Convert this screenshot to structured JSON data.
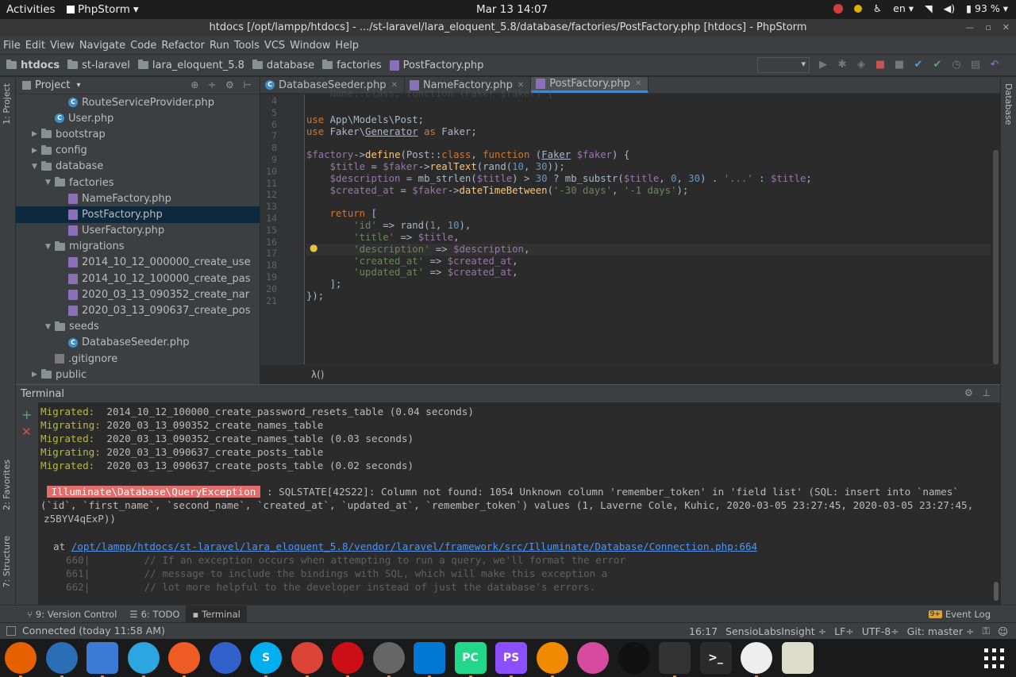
{
  "topbar": {
    "activities": "Activities",
    "app": "PhpStorm",
    "clock": "Mar 13  14:07",
    "lang": "en",
    "battery": "93 %"
  },
  "window": {
    "title": "htdocs [/opt/lampp/htdocs] - .../st-laravel/lara_eloquent_5.8/database/factories/PostFactory.php [htdocs] - PhpStorm"
  },
  "menu": [
    "File",
    "Edit",
    "View",
    "Navigate",
    "Code",
    "Refactor",
    "Run",
    "Tools",
    "VCS",
    "Window",
    "Help"
  ],
  "breadcrumbs": [
    "htdocs",
    "st-laravel",
    "lara_eloquent_5.8",
    "database",
    "factories",
    "PostFactory.php"
  ],
  "project": {
    "header": "Project",
    "tree": [
      {
        "label": "RouteServiceProvider.php",
        "icon": "class",
        "indent": 3,
        "arrow": ""
      },
      {
        "label": "User.php",
        "icon": "class",
        "indent": 2,
        "arrow": ""
      },
      {
        "label": "bootstrap",
        "icon": "folder",
        "indent": 1,
        "arrow": "▶"
      },
      {
        "label": "config",
        "icon": "folder",
        "indent": 1,
        "arrow": "▶"
      },
      {
        "label": "database",
        "icon": "folder",
        "indent": 1,
        "arrow": "▼"
      },
      {
        "label": "factories",
        "icon": "folder",
        "indent": 2,
        "arrow": "▼"
      },
      {
        "label": "NameFactory.php",
        "icon": "php",
        "indent": 3,
        "arrow": ""
      },
      {
        "label": "PostFactory.php",
        "icon": "php",
        "indent": 3,
        "arrow": "",
        "selected": true
      },
      {
        "label": "UserFactory.php",
        "icon": "php",
        "indent": 3,
        "arrow": ""
      },
      {
        "label": "migrations",
        "icon": "folder",
        "indent": 2,
        "arrow": "▼"
      },
      {
        "label": "2014_10_12_000000_create_use",
        "icon": "php",
        "indent": 3,
        "arrow": ""
      },
      {
        "label": "2014_10_12_100000_create_pas",
        "icon": "php",
        "indent": 3,
        "arrow": ""
      },
      {
        "label": "2020_03_13_090352_create_nar",
        "icon": "php",
        "indent": 3,
        "arrow": ""
      },
      {
        "label": "2020_03_13_090637_create_pos",
        "icon": "php",
        "indent": 3,
        "arrow": ""
      },
      {
        "label": "seeds",
        "icon": "folder",
        "indent": 2,
        "arrow": "▼"
      },
      {
        "label": "DatabaseSeeder.php",
        "icon": "class",
        "indent": 3,
        "arrow": ""
      },
      {
        "label": ".gitignore",
        "icon": "file",
        "indent": 2,
        "arrow": ""
      },
      {
        "label": "public",
        "icon": "folder",
        "indent": 1,
        "arrow": "▶"
      }
    ]
  },
  "tabs": [
    {
      "label": "DatabaseSeeder.php",
      "icon": "class",
      "active": false
    },
    {
      "label": "NameFactory.php",
      "icon": "php",
      "active": false
    },
    {
      "label": "PostFactory.php",
      "icon": "php",
      "active": true
    }
  ],
  "code": {
    "line_numbers": [
      "4",
      "5",
      "6",
      "7",
      "8",
      "9",
      "10",
      "11",
      "12",
      "13",
      "14",
      "15",
      "16",
      "17",
      "18",
      "19",
      "20",
      "21"
    ],
    "editor_breadcrumb": "λ()"
  },
  "terminal": {
    "title": "Terminal",
    "lines": [
      {
        "label": "Migrated:  ",
        "text": "2014_10_12_100000_create_password_resets_table (0.04 seconds)"
      },
      {
        "label": "Migrating: ",
        "text": "2020_03_13_090352_create_names_table"
      },
      {
        "label": "Migrated:  ",
        "text": "2020_03_13_090352_create_names_table (0.03 seconds)"
      },
      {
        "label": "Migrating: ",
        "text": "2020_03_13_090637_create_posts_table"
      },
      {
        "label": "Migrated:  ",
        "text": "2020_03_13_090637_create_posts_table (0.02 seconds)"
      }
    ],
    "exception_class": "Illuminate\\Database\\QueryException",
    "error_line1": " : SQLSTATE[42S22]: Column not found: 1054 Unknown column 'remember_token' in 'field list' (SQL: insert into `names`",
    "error_line2": "(`id`, `first_name`, `second_name`, `created_at`, `updated_at`, `remember_token`) values (1, Laverne Cole, Kuhic, 2020-03-05 23:27:45, 2020-03-05 23:27:45,",
    "error_line3": "z5BYV4qExP))",
    "at_label": "at ",
    "at_path": "/opt/lampp/htdocs/st-laravel/lara_eloquent_5.8/vendor/laravel/framework/src/Illuminate/Database/Connection.php:664",
    "src": [
      "660|         // If an exception occurs when attempting to run a query, we'll format the error",
      "661|         // message to include the bindings with SQL, which will make this exception a",
      "662|         // lot more helpful to the developer instead of just the database's errors."
    ]
  },
  "left_strip": {
    "project": "1: Project",
    "favorites": "2: Favorites",
    "structure": "7: Structure"
  },
  "right_strip": {
    "database": "Database"
  },
  "toolwindows": {
    "version_control": "9: Version Control",
    "todo": "6: TODO",
    "terminal": "Terminal",
    "event_log": "Event Log",
    "event_count": "9+"
  },
  "status": {
    "connected": "Connected (today 11:58 AM)",
    "position": "16:17",
    "insight": "SensioLabsInsight ÷",
    "line_sep": "LF÷",
    "encoding": "UTF-8÷",
    "git": "Git: master ÷"
  },
  "dock": [
    {
      "name": "firefox",
      "color": "#e66000"
    },
    {
      "name": "thunderbird",
      "color": "#2a6fb5"
    },
    {
      "name": "files",
      "color": "#3a7bd5"
    },
    {
      "name": "telegram",
      "color": "#2ca5e0"
    },
    {
      "name": "postman",
      "color": "#ef5b25"
    },
    {
      "name": "simplenote",
      "color": "#3361cc"
    },
    {
      "name": "skype",
      "color": "#00aff0"
    },
    {
      "name": "chrome",
      "color": "#db4437"
    },
    {
      "name": "opera",
      "color": "#cc0f16"
    },
    {
      "name": "settings",
      "color": "#666666"
    },
    {
      "name": "vscode",
      "color": "#0078d4"
    },
    {
      "name": "pycharm",
      "color": "#21d789"
    },
    {
      "name": "phpstorm",
      "color": "#8c4fff"
    },
    {
      "name": "vlc",
      "color": "#f08a00"
    },
    {
      "name": "kite",
      "color": "#d64aa0"
    },
    {
      "name": "music",
      "color": "#111111"
    },
    {
      "name": "system-monitor",
      "color": "#333333"
    },
    {
      "name": "terminal",
      "color": "#2b2b2b"
    },
    {
      "name": "search",
      "color": "#eeeeee"
    },
    {
      "name": "text-editor",
      "color": "#ddddcc"
    }
  ],
  "dock_labels": {
    "pycharm": "PC",
    "phpstorm": "PS",
    "skype": "S",
    "terminal": ">_"
  }
}
